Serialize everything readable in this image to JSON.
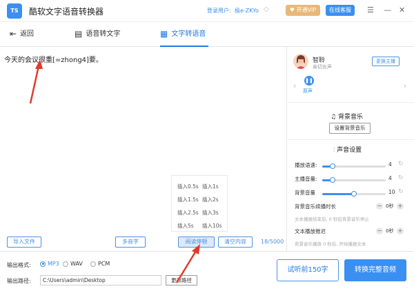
{
  "app": {
    "logo_text": "TS",
    "title": "酷软文字语音转换器"
  },
  "user": {
    "login_label": "登录用户:",
    "name": "极e-ZKYo",
    "vip_label": "开通VIP",
    "service_label": "在线客服"
  },
  "window": {
    "settings_icon": "menu-icon",
    "minimize": "—",
    "close": "✕"
  },
  "tabs": [
    {
      "label": "返回",
      "icon": "back-icon"
    },
    {
      "label": "语音转文字",
      "icon": "voice-to-text-icon"
    },
    {
      "label": "文字转语音",
      "icon": "text-to-voice-icon",
      "active": true
    }
  ],
  "editor": {
    "content": "今天的会议很重[=zhong4]要。",
    "char_count": "18/5000"
  },
  "insert_pauses": [
    "插入0.5s",
    "插入1s",
    "插入1.5s",
    "插入2s",
    "插入2.5s",
    "插入3s",
    "插入5s",
    "插入10s"
  ],
  "editor_buttons": {
    "import": "导入文件",
    "polyphone": "多音字",
    "pause": "阅读停顿",
    "clear": "清空内容"
  },
  "voice": {
    "name": "智聆",
    "desc": "亲切女声",
    "change_label": "更换主播",
    "preview_label": "原声"
  },
  "bgm": {
    "title": "背景音乐",
    "set_label": "设置背景音乐"
  },
  "sound": {
    "title": "声音设置",
    "sliders": [
      {
        "label": "播放语速:",
        "value": 4,
        "max": 10
      },
      {
        "label": "主播音量:",
        "value": 4,
        "max": 10
      },
      {
        "label": "背景音量",
        "value": 10,
        "max": 10
      }
    ],
    "bgm_delay": {
      "label": "背景音乐续播时长",
      "value": "0秒",
      "hint": "文本播报结束后, 0 秒后背景音乐停止"
    },
    "text_delay": {
      "label": "文本播放推迟",
      "value": "0秒",
      "hint": "背景音乐播放 0 秒后, 开始播报文本"
    }
  },
  "output": {
    "format_label": "输出格式:",
    "formats": [
      "MP3",
      "WAV",
      "PCM"
    ],
    "selected_format": "MP3",
    "path_label": "输出路径:",
    "path": "C:\\Users\\admin\\Desktop",
    "change_path_label": "更改路径"
  },
  "actions": {
    "try_label": "试听前150字",
    "convert_label": "转换完整音频"
  },
  "colors": {
    "accent": "#3a8ff0",
    "vip": "#e8b878",
    "annotation": "#e03a2a"
  }
}
